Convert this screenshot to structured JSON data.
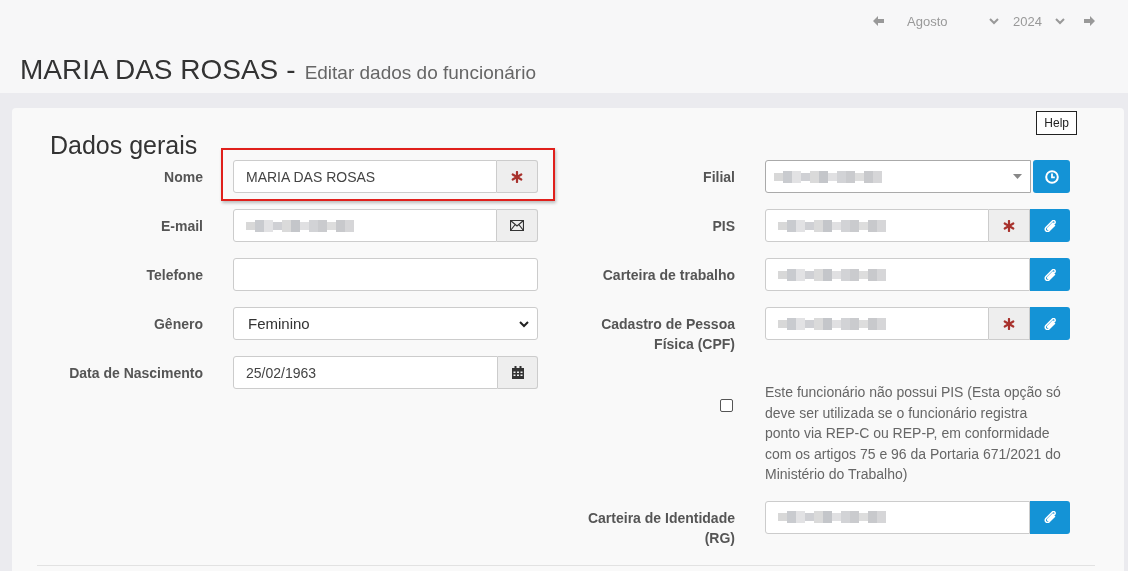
{
  "period_nav": {
    "month": "Agosto",
    "year": "2024"
  },
  "header": {
    "title": "MARIA DAS ROSAS",
    "separator": "-",
    "subtitle": "Editar dados do funcionário"
  },
  "help_tooltip": "Help",
  "section_title": "Dados gerais",
  "left_fields": [
    {
      "label": "Nome",
      "kind": "text",
      "value": "MARIA DAS ROSAS",
      "highlighted": true,
      "addons": [
        {
          "kind": "required"
        }
      ]
    },
    {
      "label": "E-mail",
      "kind": "text",
      "redacted": true,
      "addons": [
        {
          "kind": "email"
        }
      ]
    },
    {
      "label": "Telefone",
      "kind": "text"
    },
    {
      "label": "Gênero",
      "kind": "select",
      "value": "Feminino"
    },
    {
      "label": "Data de Nascimento",
      "kind": "text",
      "value": "25/02/1963",
      "addons": [
        {
          "kind": "calendar"
        }
      ]
    }
  ],
  "right_fields": [
    {
      "label": "Filial",
      "kind": "combo",
      "redacted": true,
      "addons": [
        {
          "kind": "clock"
        }
      ]
    },
    {
      "label": "PIS",
      "kind": "text",
      "redacted": true,
      "addons": [
        {
          "kind": "required"
        },
        {
          "kind": "attach"
        }
      ]
    },
    {
      "label": "Carteira de trabalho",
      "kind": "text",
      "redacted": true,
      "addons": [
        {
          "kind": "attach"
        }
      ]
    },
    {
      "label": "Cadastro de Pessoa Física (CPF)",
      "kind": "text",
      "redacted": true,
      "addons": [
        {
          "kind": "required"
        },
        {
          "kind": "attach"
        }
      ]
    },
    {
      "kind": "checkbox",
      "checked": false,
      "text": "Este funcionário não possui PIS (Esta opção só deve ser utilizada se o funcionário registra ponto via REP-C ou REP-P, em conformidade com os artigos 75 e 96 da Portaria 671/2021 do Ministério do Trabalho)"
    },
    {
      "label": "Carteira de Identidade (RG)",
      "kind": "text",
      "redacted": true,
      "addons": [
        {
          "kind": "attach"
        }
      ]
    }
  ]
}
